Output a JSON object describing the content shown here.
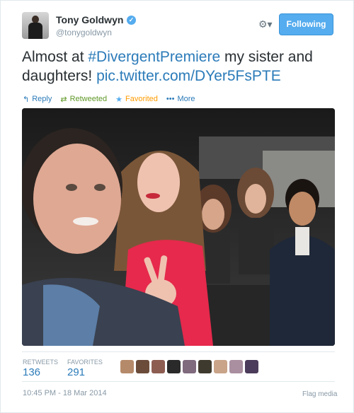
{
  "tweet": {
    "author_name": "Tony Goldwyn",
    "handle": "@tonygoldwyn",
    "verified_glyph": "✓",
    "follow_label": "Following",
    "gear_glyph": "⚙▾",
    "text_lead": "Almost at ",
    "hashtag": "#DivergentPremiere",
    "text_mid": " my sister and daughters! ",
    "pic_link": "pic.twitter.com/DYer5FsPTE"
  },
  "actions": {
    "reply": "Reply",
    "retweeted": "Retweeted",
    "favorited": "Favorited",
    "more": "More"
  },
  "icons": {
    "reply": "↰",
    "retweet": "⇄",
    "favorite": "★",
    "more": "•••"
  },
  "stats": {
    "retweets_label": "RETWEETS",
    "retweets_count": "136",
    "favorites_label": "FAVORITES",
    "favorites_count": "291"
  },
  "favoriters": [
    {
      "name": "favoriter-1",
      "color": "#b58a6a"
    },
    {
      "name": "favoriter-2",
      "color": "#6b4c3b"
    },
    {
      "name": "favoriter-3",
      "color": "#8e5d52"
    },
    {
      "name": "favoriter-4",
      "color": "#2a2a2a"
    },
    {
      "name": "favoriter-5",
      "color": "#7f6a7e"
    },
    {
      "name": "favoriter-6",
      "color": "#3f3a2e"
    },
    {
      "name": "favoriter-7",
      "color": "#c9a489"
    },
    {
      "name": "favoriter-8",
      "color": "#a98fa0"
    },
    {
      "name": "favoriter-9",
      "color": "#4a3c5a"
    }
  ],
  "footer": {
    "timestamp": "10:45 PM - 18 Mar 2014",
    "flag": "Flag media"
  },
  "colors": {
    "link": "#2b7bb9",
    "follow_button": "#55acee",
    "retweeted": "#609928",
    "favorited": "#ff9b00",
    "muted": "#8899a6"
  }
}
